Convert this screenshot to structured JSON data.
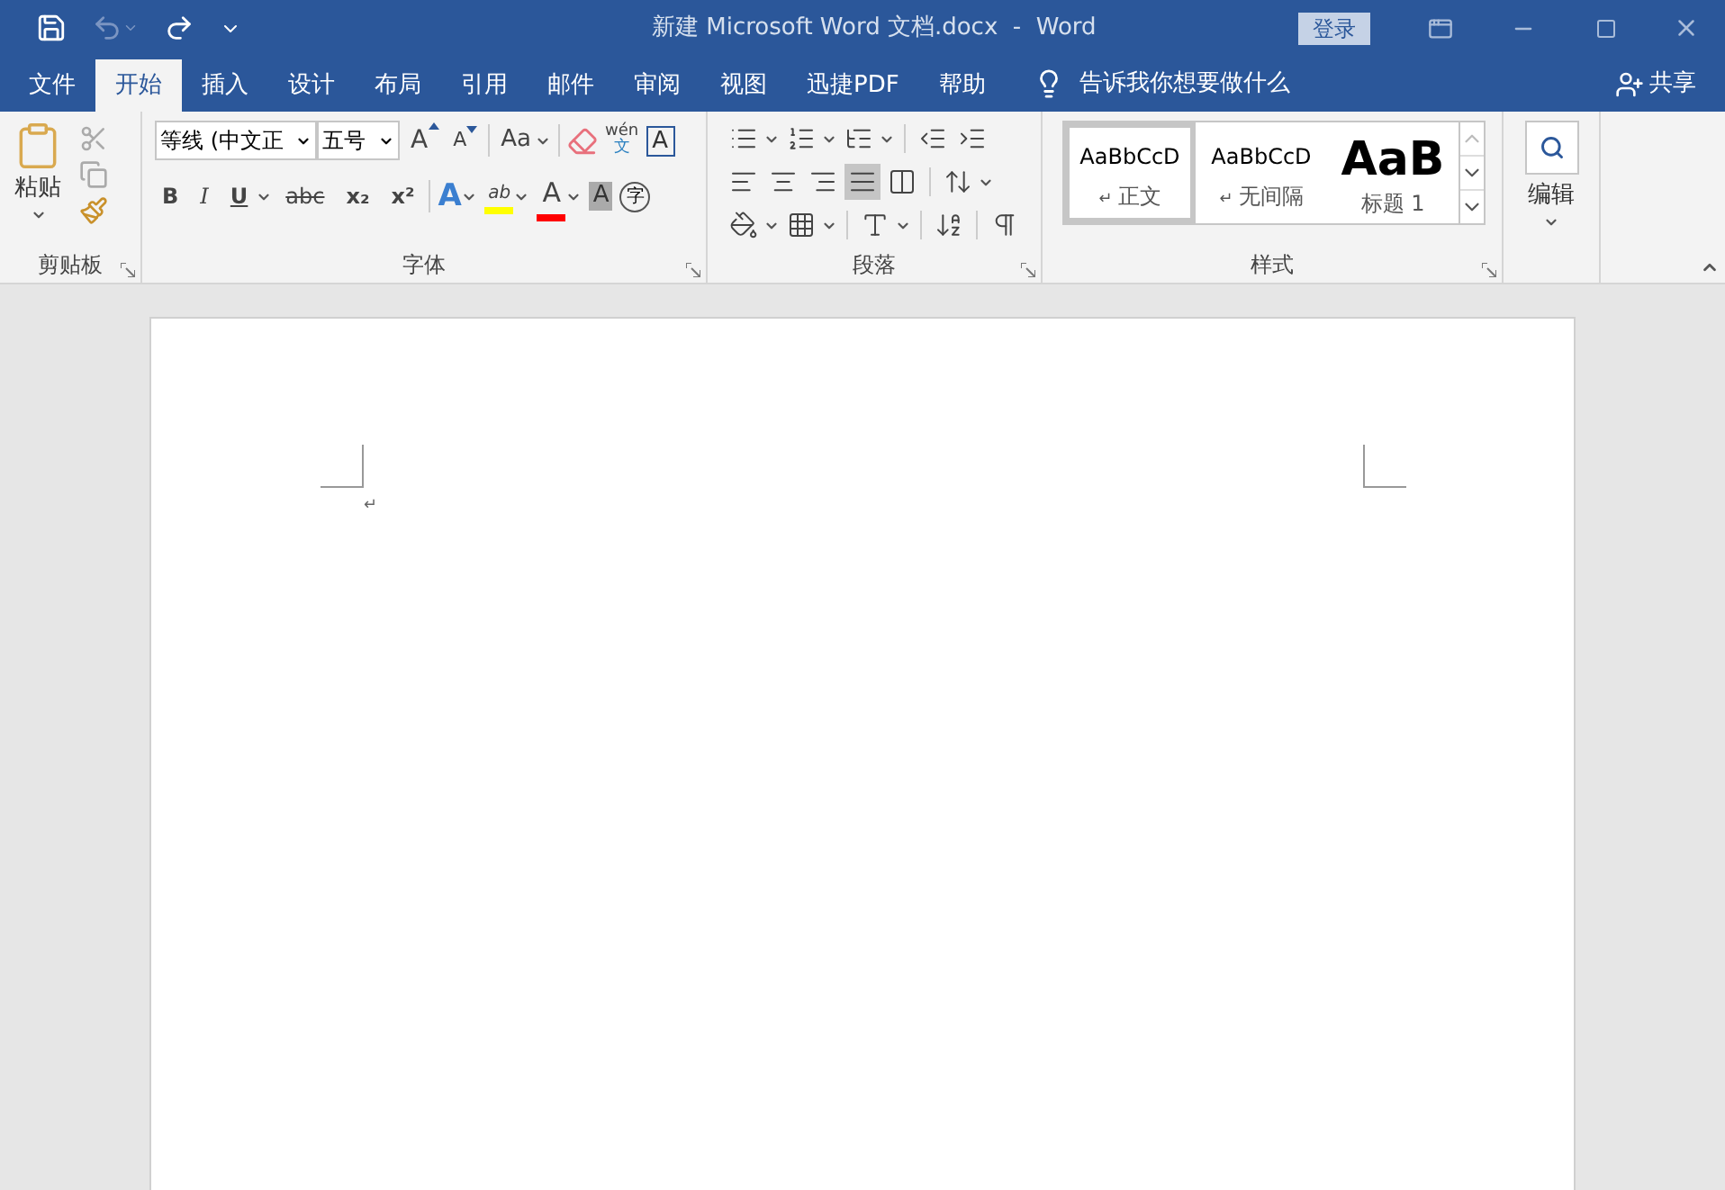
{
  "window": {
    "title": "新建 Microsoft Word 文档.docx  -  Word",
    "sign_in": "登录"
  },
  "tabs": [
    {
      "label": "文件",
      "selected": false
    },
    {
      "label": "开始",
      "selected": true
    },
    {
      "label": "插入",
      "selected": false
    },
    {
      "label": "设计",
      "selected": false
    },
    {
      "label": "布局",
      "selected": false
    },
    {
      "label": "引用",
      "selected": false
    },
    {
      "label": "邮件",
      "selected": false
    },
    {
      "label": "审阅",
      "selected": false
    },
    {
      "label": "视图",
      "selected": false
    },
    {
      "label": "迅捷PDF",
      "selected": false
    },
    {
      "label": "帮助",
      "selected": false
    }
  ],
  "tell_me": "告诉我你想要做什么",
  "share": "共享",
  "clipboard": {
    "label": "剪贴板",
    "paste": "粘贴"
  },
  "font": {
    "label": "字体",
    "font_name": "等线 (中文正",
    "font_size": "五号",
    "change_case": "Aa",
    "phonetic": "wén",
    "phonetic_sub": "文",
    "border_char": "A",
    "grow": "A",
    "shrink": "A",
    "format_buttons": [
      {
        "label": "B",
        "kind": "bold"
      },
      {
        "label": "I",
        "kind": "italic"
      },
      {
        "label": "U",
        "kind": "underline"
      },
      {
        "label": "abc",
        "kind": "strike"
      },
      {
        "label": "x₂",
        "kind": "sub"
      },
      {
        "label": "x²",
        "kind": "sup"
      }
    ],
    "effects": [
      {
        "label": "A",
        "kind": "text-effect"
      },
      {
        "label": "ab",
        "kind": "highlight",
        "color": "#ffff00"
      },
      {
        "label": "A",
        "kind": "font-color",
        "color": "#ff0000"
      },
      {
        "label": "A",
        "kind": "char-shading"
      },
      {
        "label": "字",
        "kind": "enclose"
      }
    ]
  },
  "paragraph": {
    "label": "段落",
    "alignments": [
      {
        "kind": "left",
        "selected": false
      },
      {
        "kind": "center",
        "selected": false
      },
      {
        "kind": "right",
        "selected": false
      },
      {
        "kind": "justify",
        "selected": true
      },
      {
        "kind": "distributed",
        "selected": false
      }
    ]
  },
  "styles": {
    "label": "样式",
    "items": [
      {
        "preview": "AaBbCcD",
        "name": "正文",
        "mark": "↵",
        "kind": "normal",
        "selected": true
      },
      {
        "preview": "AaBbCcD",
        "name": "无间隔",
        "mark": "↵",
        "kind": "normal",
        "selected": false
      },
      {
        "preview": "AaB",
        "name": "标题 1",
        "kind": "heading",
        "selected": false
      }
    ]
  },
  "editing": {
    "label": "编辑"
  },
  "document": {
    "paragraph_mark": "↵"
  }
}
